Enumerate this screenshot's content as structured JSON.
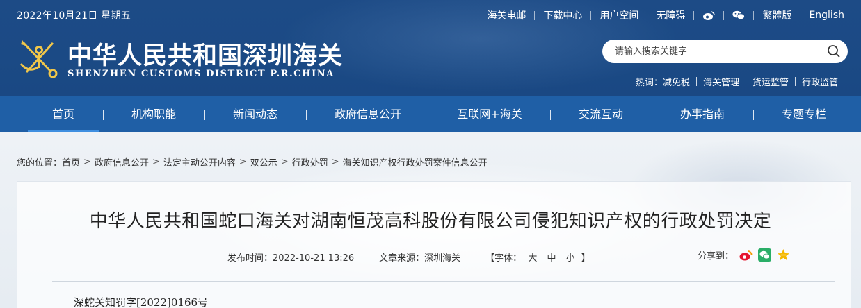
{
  "header": {
    "date": "2022年10月21日 星期五",
    "top_links": [
      "海关电邮",
      "下载中心",
      "用户空间",
      "无障碍",
      "繁體版",
      "English"
    ],
    "title": "中华人民共和国深圳海关",
    "subtitle": "SHENZHEN CUSTOMS DISTRICT P.R.CHINA",
    "search_placeholder": "请输入搜索关键字",
    "hot_label": "热词：",
    "hot_words": [
      "减免税",
      "海关管理",
      "货运监管",
      "行政监管"
    ]
  },
  "nav": {
    "items": [
      "首页",
      "机构职能",
      "新闻动态",
      "政府信息公开",
      "互联网+海关",
      "交流互动",
      "办事指南",
      "专题专栏"
    ],
    "active_index": 0
  },
  "breadcrumb": {
    "prefix": "您的位置：",
    "items": [
      "首页",
      "政府信息公开",
      "法定主动公开内容",
      "双公示",
      "行政处罚",
      "海关知识产权行政处罚案件信息公开"
    ]
  },
  "article": {
    "title": "中华人民共和国蛇口海关对湖南恒茂高科股份有限公司侵犯知识产权的行政处罚决定",
    "publish_time": "发布时间：2022-10-21 13:26",
    "source": "文章来源：深圳海关",
    "font_label_open": "【字体：",
    "font_sizes": [
      "大",
      "中",
      "小"
    ],
    "font_label_close": "】",
    "share_label": "分享到：",
    "doc_number": "深蛇关知罚字[2022]0166号"
  },
  "colors": {
    "header_bg": "#1b4a85",
    "nav_bg": "#1f5fa6",
    "nav_active_underline": "#3f8fe0"
  }
}
